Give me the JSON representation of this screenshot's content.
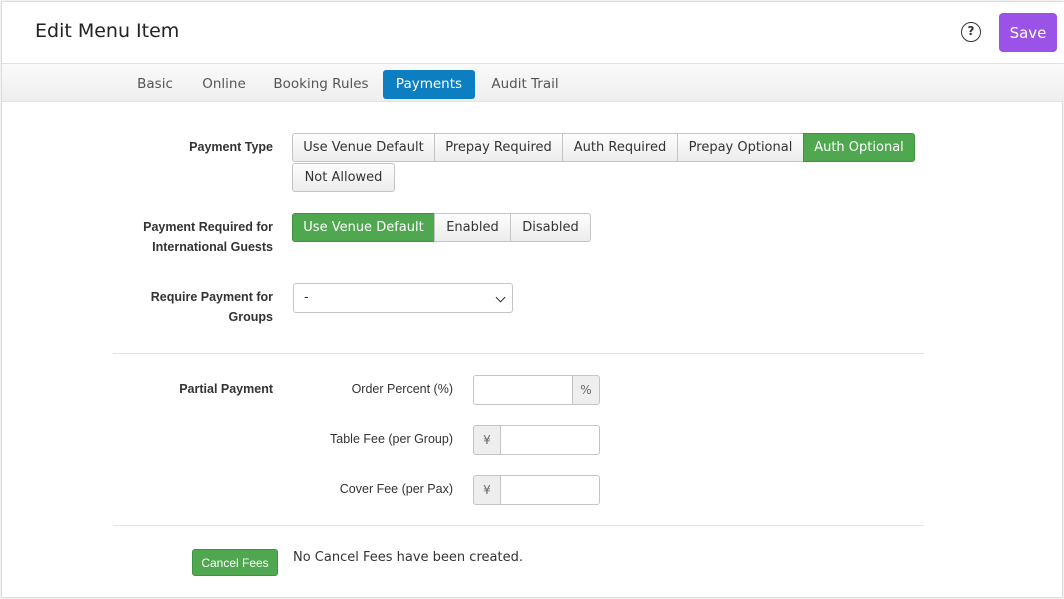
{
  "header": {
    "title": "Edit Menu Item",
    "help_glyph": "?",
    "save_label": "Save",
    "save_color": "#9b52e6"
  },
  "tabs": [
    {
      "label": "Basic",
      "active": false
    },
    {
      "label": "Online",
      "active": false
    },
    {
      "label": "Booking Rules",
      "active": false
    },
    {
      "label": "Payments",
      "active": true
    },
    {
      "label": "Audit Trail",
      "active": false
    }
  ],
  "payment_type": {
    "label": "Payment Type",
    "options": [
      "Use Venue Default",
      "Prepay Required",
      "Auth Required",
      "Prepay Optional",
      "Auth Optional",
      "Not Allowed"
    ],
    "selected": "Auth Optional"
  },
  "international": {
    "label_line1": "Payment Required for",
    "label_line2": "International Guests",
    "options": [
      "Use Venue Default",
      "Enabled",
      "Disabled"
    ],
    "selected": "Use Venue Default"
  },
  "groups": {
    "label_line1": "Require Payment for",
    "label_line2": "Groups",
    "selected_value": "-"
  },
  "partial_payment": {
    "label": "Partial Payment",
    "order_percent_label": "Order Percent (%)",
    "order_percent_value": "",
    "percent_addon": "%",
    "table_fee_label": "Table Fee (per Group)",
    "table_fee_value": "",
    "cover_fee_label": "Cover Fee (per Pax)",
    "cover_fee_value": "",
    "currency_addon": "¥"
  },
  "cancel_fees": {
    "button_label": "Cancel Fees",
    "empty_text": "No Cancel Fees have been created."
  },
  "colors": {
    "accent_green": "#4fa84f",
    "tab_active_blue": "#0d7ec2"
  }
}
